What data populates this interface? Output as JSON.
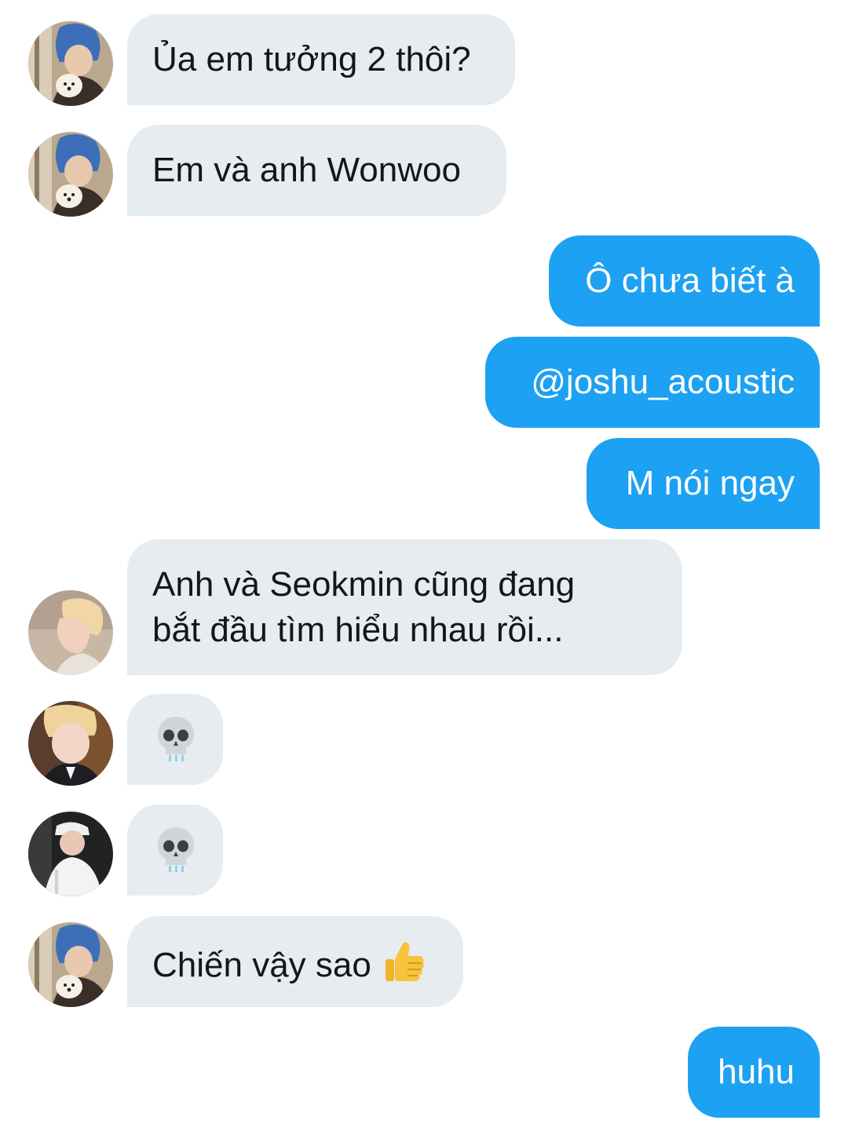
{
  "conversation": {
    "messages": [
      {
        "side": "incoming",
        "avatar": "blue-hair-with-puppy-avatar",
        "text": "Ủa em tưởng 2 thôi?"
      },
      {
        "side": "incoming",
        "avatar": "blue-hair-with-puppy-avatar",
        "text": "Em và anh Wonwoo"
      },
      {
        "side": "outgoing",
        "text": "Ô chưa biết à"
      },
      {
        "side": "outgoing",
        "text": "@joshu_acoustic"
      },
      {
        "side": "outgoing",
        "text": "M nói ngay"
      },
      {
        "side": "incoming",
        "avatar": "blonde-profile-avatar",
        "text_line1": "Anh và Seokmin cũng đang",
        "text_line2": "bắt đầu tìm hiểu nhau rồi..."
      },
      {
        "side": "incoming",
        "avatar": "selfie-blonde-suit-avatar",
        "emoji": "skull-icon"
      },
      {
        "side": "incoming",
        "avatar": "white-outfit-cap-avatar",
        "emoji": "skull-icon"
      },
      {
        "side": "incoming",
        "avatar": "blue-hair-with-puppy-avatar",
        "text": "Chiến vậy sao",
        "emoji": "thumbs-up-icon"
      },
      {
        "side": "outgoing",
        "text": "huhu"
      }
    ]
  },
  "colors": {
    "incoming_bubble": "#e6ecf0",
    "outgoing_bubble": "#1da1f2",
    "incoming_text": "#14171a",
    "outgoing_text": "#ffffff"
  }
}
